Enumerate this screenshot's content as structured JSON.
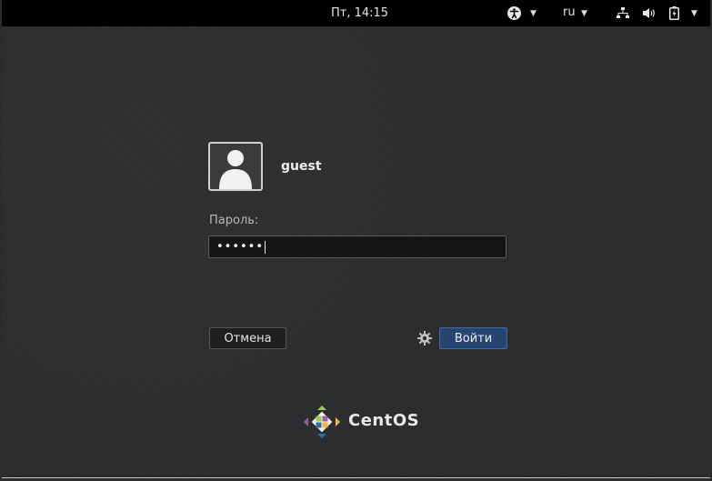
{
  "topbar": {
    "clock": "Пт, 14:15",
    "language": "ru",
    "icons": [
      "accessibility-icon",
      "network-icon",
      "volume-icon",
      "battery-icon",
      "system-menu-caret"
    ]
  },
  "login": {
    "username": "guest",
    "password_label": "Пароль:",
    "password_mask": "••••••",
    "cancel_label": "Отмена",
    "submit_label": "Войти"
  },
  "branding": {
    "text": "CentOS"
  },
  "colors": {
    "accent": "#27456e",
    "background": "#2b2c2e",
    "topbar": "#000000"
  }
}
